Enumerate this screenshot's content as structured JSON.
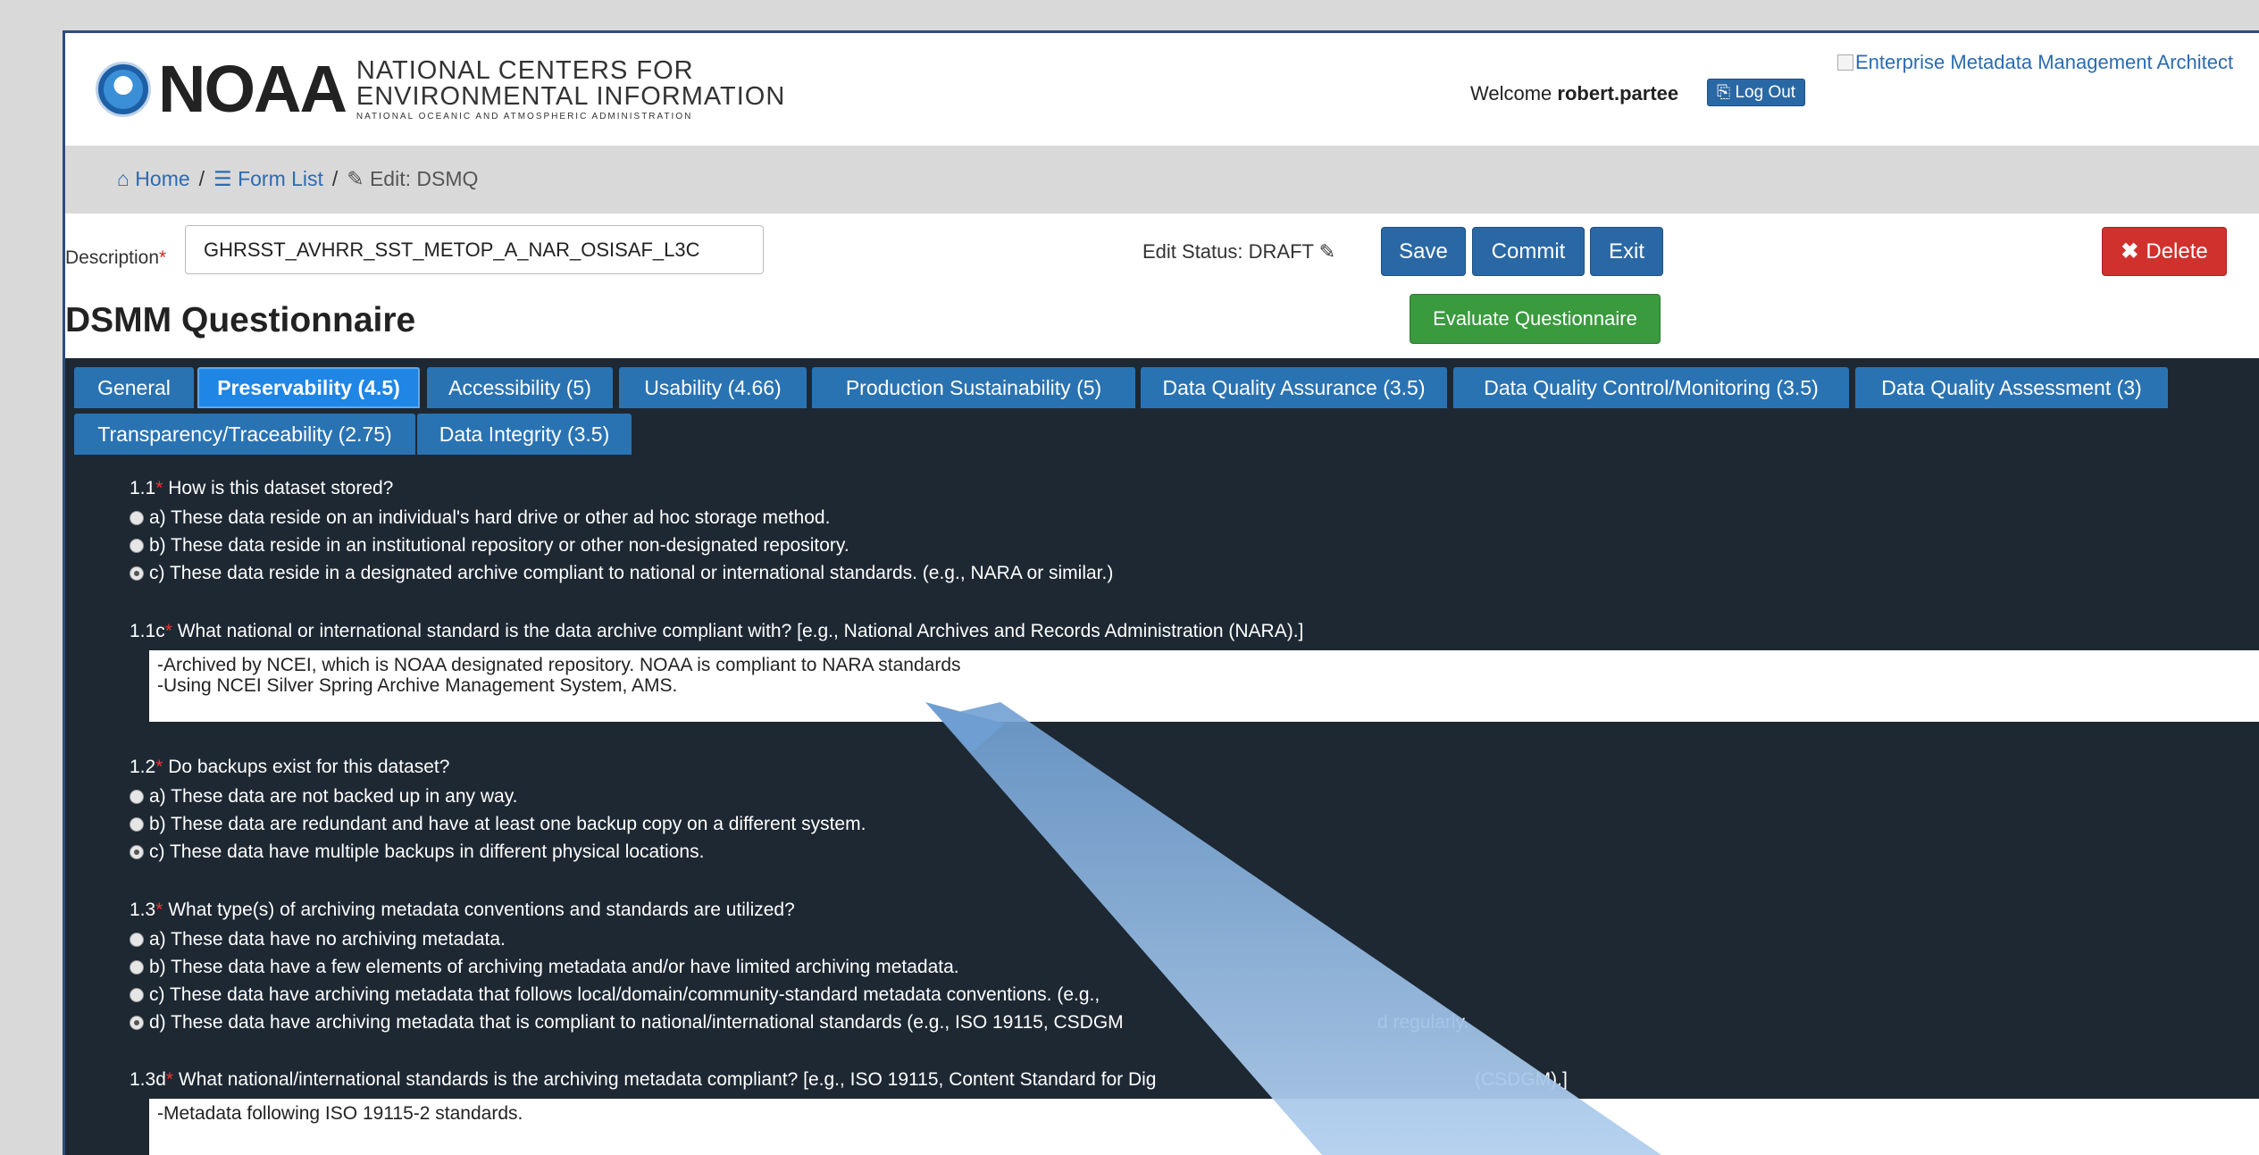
{
  "header": {
    "logo_noaa": "NOAA",
    "logo_line1": "NATIONAL CENTERS FOR",
    "logo_line2": "ENVIRONMENTAL INFORMATION",
    "logo_line3": "NATIONAL OCEANIC AND ATMOSPHERIC ADMINISTRATION",
    "welcome_prefix": "Welcome",
    "username": "robert.partee",
    "logout_label": "Log Out",
    "broken_image_alt": "Enterprise Metadata Management Architect"
  },
  "breadcrumb": {
    "home": "Home",
    "form_list": "Form List",
    "current": "Edit: DSMQ",
    "separator": "/"
  },
  "form": {
    "description_label": "Description",
    "description_value": "GHRSST_AVHRR_SST_METOP_A_NAR_OSISAF_L3C",
    "edit_status": "Edit Status: DRAFT",
    "save_label": "Save",
    "commit_label": "Commit",
    "exit_label": "Exit",
    "delete_label": "Delete",
    "evaluate_label": "Evaluate Questionnaire",
    "title": "DSMM Questionnaire"
  },
  "tabs": [
    {
      "label": "General",
      "active": false
    },
    {
      "label": "Preservability (4.5)",
      "active": true
    },
    {
      "label": "Accessibility (5)",
      "active": false
    },
    {
      "label": "Usability (4.66)",
      "active": false
    },
    {
      "label": "Production Sustainability (5)",
      "active": false
    },
    {
      "label": "Data Quality Assurance (3.5)",
      "active": false
    },
    {
      "label": "Data Quality Control/Monitoring (3.5)",
      "active": false
    },
    {
      "label": "Data Quality Assessment (3)",
      "active": false
    },
    {
      "label": "Transparency/Traceability (2.75)",
      "active": false
    },
    {
      "label": "Data Integrity (3.5)",
      "active": false
    }
  ],
  "questions": {
    "q1_1": {
      "number": "1.1",
      "text": "How is this dataset stored?",
      "options": [
        "a) These data reside on an individual's hard drive or other ad hoc storage method.",
        "b) These data reside in an institutional repository or other non-designated repository.",
        "c) These data reside in a designated archive compliant to national or international standards. (e.g., NARA or similar.)"
      ],
      "selected": 2
    },
    "q1_1c": {
      "number": "1.1c",
      "text": "What national or international standard is the data archive compliant with? [e.g., National Archives and Records Administration (NARA).]",
      "answer": "-Archived by NCEI, which is NOAA designated repository. NOAA is compliant to NARA standards\n-Using NCEI Silver Spring Archive Management System, AMS."
    },
    "q1_2": {
      "number": "1.2",
      "text": "Do backups exist for this dataset?",
      "options": [
        "a) These data are not backed up in any way.",
        "b) These data are redundant and have at least one backup copy on a different system.",
        "c) These data have multiple backups in different physical locations."
      ],
      "selected": 2
    },
    "q1_3": {
      "number": "1.3",
      "text": "What type(s) of archiving metadata conventions and standards are utilized?",
      "options": [
        "a) These data have no archiving metadata.",
        "b) These data have a few elements of archiving metadata and/or have limited archiving metadata.",
        "c) These data have archiving metadata that follows local/domain/community-standard metadata conventions. (e.g.,",
        "d) These data have archiving metadata that is compliant to national/international standards (e.g., ISO 19115, CSDGM",
        "d regularly."
      ],
      "selected": 3
    },
    "q1_3d": {
      "number": "1.3d",
      "text": "What national/international standards is the archiving metadata compliant? [e.g., ISO 19115, Content Standard for Dig",
      "text_tail": "(CSDGM).]",
      "answer": "-Metadata following ISO 19115-2 standards."
    }
  },
  "colors": {
    "primary": "#2a68a5",
    "danger": "#d0312d",
    "success": "#3a9a3e",
    "panel": "#1d2833",
    "arrow": "#8fb4dc"
  }
}
